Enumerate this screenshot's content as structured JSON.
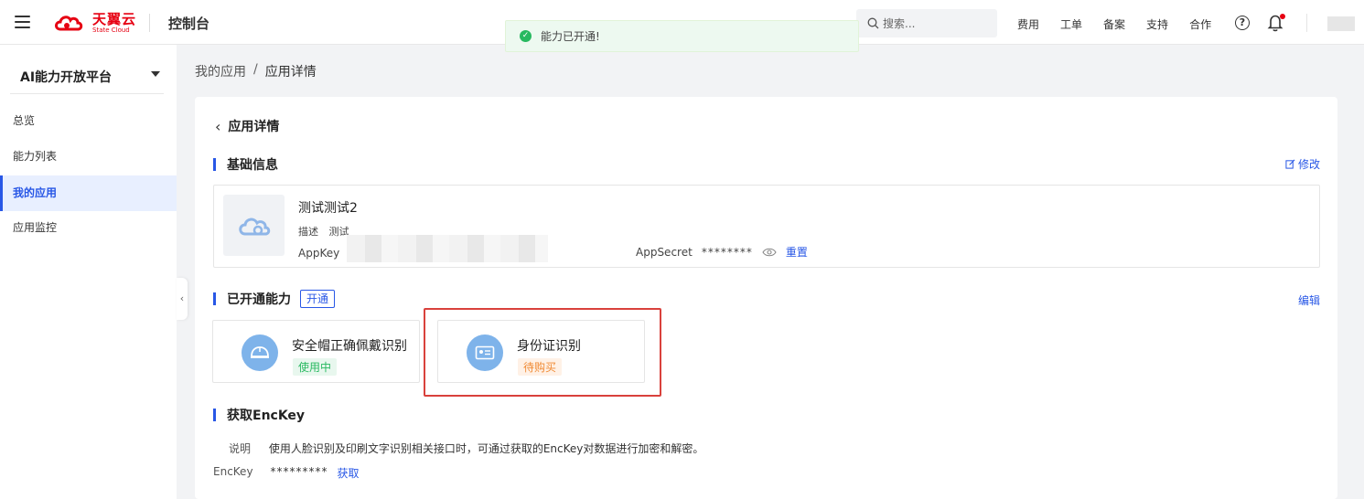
{
  "topbar": {
    "brand_cn": "天翼云",
    "brand_en": "State Cloud",
    "console_title": "控制台",
    "search_placeholder": "搜索...",
    "nav": [
      "费用",
      "工单",
      "备案",
      "支持",
      "合作"
    ],
    "help_glyph": "?"
  },
  "toast": {
    "message": "能力已开通!",
    "status_color": "#28b960"
  },
  "sidebar": {
    "title": "AI能力开放平台",
    "items": [
      {
        "label": "总览"
      },
      {
        "label": "能力列表"
      },
      {
        "label": "我的应用",
        "active": true
      },
      {
        "label": "应用监控"
      }
    ]
  },
  "breadcrumb": {
    "parent": "我的应用",
    "separator": "/",
    "current": "应用详情"
  },
  "page": {
    "title": "应用详情",
    "basic_info": {
      "section_label": "基础信息",
      "edit_label": "修改",
      "app_name": "测试测试2",
      "desc_key": "描述",
      "desc_value": "测试",
      "appkey_label": "AppKey",
      "appsecret_label": "AppSecret",
      "appsecret_value": "********",
      "reset_label": "重置"
    },
    "capabilities": {
      "section_label": "已开通能力",
      "open_button": "开通",
      "edit_label": "编辑",
      "items": [
        {
          "name": "安全帽正确佩戴识别",
          "status": "使用中",
          "status_color": "#28b960"
        },
        {
          "name": "身份证识别",
          "status": "待购买",
          "status_color": "#f08a34"
        }
      ]
    },
    "enckey": {
      "section_label": "获取EncKey",
      "desc_key": "说明",
      "desc_value": "使用人脸识别及印刷文字识别相关接口时，可通过获取的EncKey对数据进行加密和解密。",
      "key_label": "EncKey",
      "key_value": "*********",
      "fetch_label": "获取"
    }
  },
  "colors": {
    "brand_red": "#e60012",
    "accent_blue": "#2857e6",
    "highlight_red": "#d9413c"
  }
}
